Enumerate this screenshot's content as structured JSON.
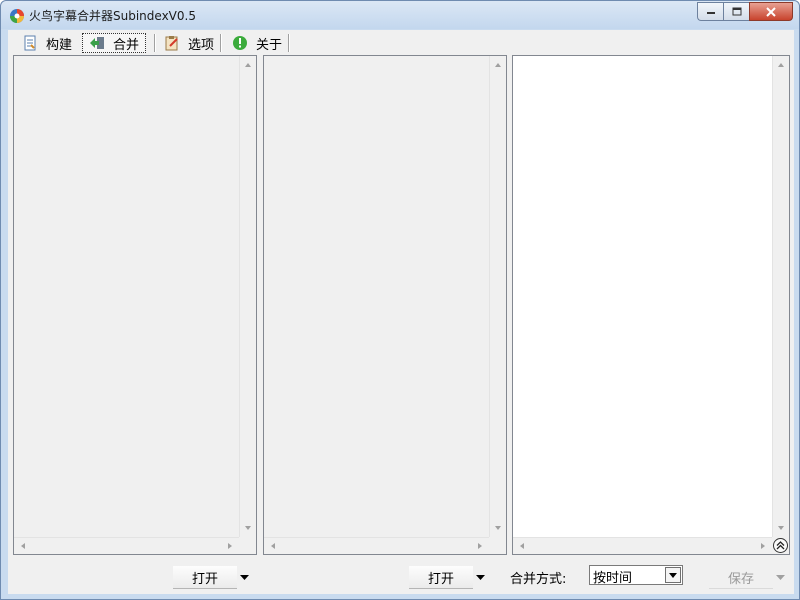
{
  "window": {
    "title": "火鸟字幕合并器SubindexV0.5"
  },
  "toolbar": {
    "items": [
      {
        "label": "构建",
        "icon": "build-doc-icon"
      },
      {
        "label": "合并",
        "icon": "merge-arrow-icon",
        "active": true
      },
      {
        "label": "选项",
        "icon": "options-clipboard-icon"
      },
      {
        "label": "关于",
        "icon": "about-info-icon"
      }
    ]
  },
  "panels": {
    "left": {
      "bg": "#f0f0f0"
    },
    "middle": {
      "bg": "#f0f0f0"
    },
    "right": {
      "bg": "#ffffff"
    }
  },
  "bottom": {
    "open_left_label": "打开",
    "open_middle_label": "打开",
    "merge_mode_label": "合并方式:",
    "merge_mode_value": "按时间",
    "save_label": "保存"
  },
  "colors": {
    "window_frame": "#c9dbef",
    "client_bg": "#f0f0f0",
    "close_button": "#c8432d"
  }
}
